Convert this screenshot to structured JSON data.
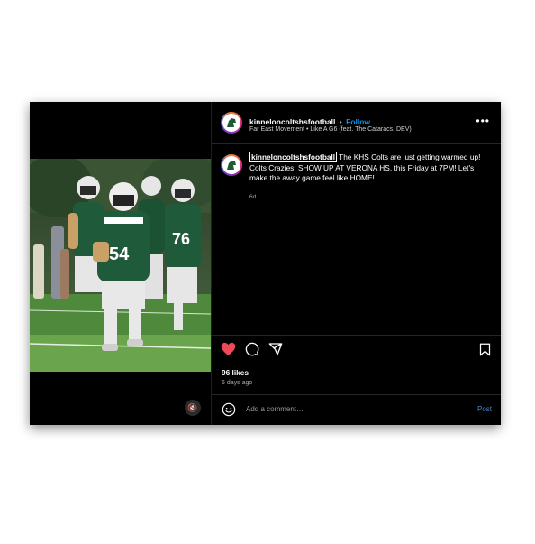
{
  "post": {
    "username": "kinneloncoltshsfootball",
    "separator": "•",
    "follow_label": "Follow",
    "audio_track": "Far East Movement • Like A G6 (feat. The Cataracs, DEV)",
    "more_icon": "more-horizontal-icon",
    "caption": {
      "username": "kinneloncoltshsfootball",
      "text": "The KHS Colts are just getting warmed up! Colts Crazies: SHOW UP AT VERONA HS, this Friday at 7PM! Let's make the away game feel like HOME!"
    },
    "caption_age": "6d",
    "likes": "96 likes",
    "posted_ago": "6 days ago",
    "liked": true,
    "icons": [
      "heart-filled-icon",
      "comment-icon",
      "share-icon",
      "bookmark-icon",
      "emoji-icon",
      "mute-icon"
    ]
  },
  "comment": {
    "placeholder": "Add a comment…",
    "post_label": "Post"
  },
  "colors": {
    "background": "#000000",
    "accent": "#0095f6",
    "like": "#ed4956",
    "jersey": "#1f5a3a"
  }
}
